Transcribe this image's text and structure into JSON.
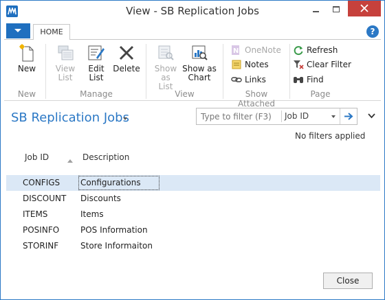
{
  "window": {
    "title": "View - SB Replication Jobs"
  },
  "ribbon": {
    "tab_home": "HOME",
    "help_glyph": "?",
    "buttons": {
      "new": "New",
      "view_list_1": "View",
      "view_list_2": "List",
      "edit_list_1": "Edit",
      "edit_list_2": "List",
      "delete": "Delete",
      "show_as_list_1": "Show",
      "show_as_list_2": "as List",
      "show_as_chart_1": "Show as",
      "show_as_chart_2": "Chart",
      "onenote": "OneNote",
      "notes": "Notes",
      "links": "Links",
      "refresh": "Refresh",
      "clear_filter": "Clear Filter",
      "find": "Find"
    },
    "groups": {
      "new": "New",
      "manage": "Manage",
      "view": "View",
      "show_attached": "Show Attached",
      "page": "Page"
    }
  },
  "page": {
    "title": "SB Replication Jobs",
    "filter": {
      "placeholder": "Type to filter (F3)",
      "field": "Job ID"
    },
    "no_filters": "No filters applied"
  },
  "table": {
    "columns": [
      "Job ID",
      "Description"
    ],
    "rows": [
      {
        "job_id": "CONFIGS",
        "description": "Configurations"
      },
      {
        "job_id": "DISCOUNT",
        "description": "Discounts"
      },
      {
        "job_id": "ITEMS",
        "description": "Items"
      },
      {
        "job_id": "POSINFO",
        "description": "POS Information"
      },
      {
        "job_id": "STORINF",
        "description": "Store Informaiton"
      }
    ],
    "selected_row": 0
  },
  "footer": {
    "close_label": "Close"
  },
  "colors": {
    "accent": "#2b78c5",
    "selected_row": "#dbe8f6",
    "close_button": "#c6413c"
  },
  "icons": [
    "app-logo-icon",
    "minimize-icon",
    "maximize-icon",
    "close-icon",
    "new-icon",
    "view-list-icon",
    "edit-list-icon",
    "delete-icon",
    "show-as-list-icon",
    "show-as-chart-icon",
    "onenote-icon",
    "notes-icon",
    "links-icon",
    "refresh-icon",
    "clear-filter-icon",
    "find-icon",
    "arrow-right-icon",
    "chevron-down-icon"
  ]
}
